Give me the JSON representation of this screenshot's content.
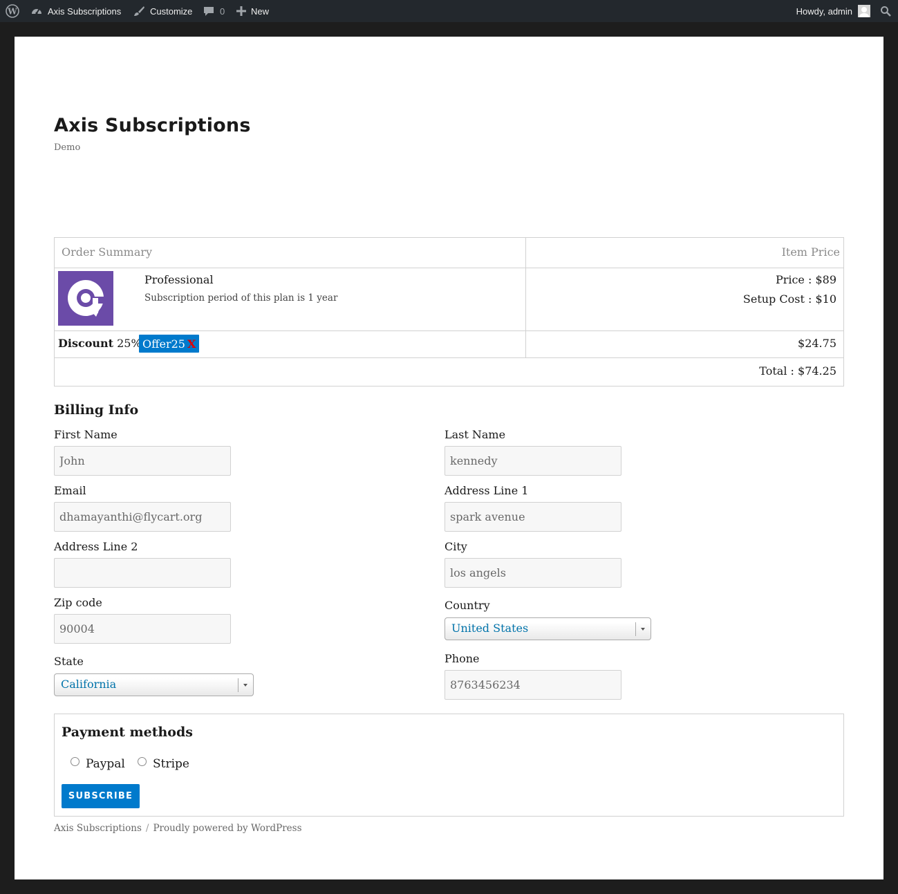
{
  "admin_bar": {
    "site_name": "Axis Subscriptions",
    "customize": "Customize",
    "comments_count": "0",
    "new_label": "New",
    "howdy": "Howdy, admin"
  },
  "site": {
    "title": "Axis Subscriptions",
    "description": "Demo"
  },
  "order": {
    "header_summary": "Order Summary",
    "header_price": "Item Price",
    "plan_name": "Professional",
    "plan_description": "Subscription period of this plan is 1 year",
    "price_line": "Price : $89",
    "setup_line": "Setup Cost : $10",
    "discount_label": "Discount",
    "discount_percent": "25%",
    "coupon_code": "Offer25",
    "coupon_remove": "X",
    "discount_amount": "$24.75",
    "total_line": "Total : $74.25"
  },
  "billing": {
    "title": "Billing Info",
    "first_name_label": "First Name",
    "first_name_value": "John",
    "last_name_label": "Last Name",
    "last_name_value": "kennedy",
    "email_label": "Email",
    "email_value": "dhamayanthi@flycart.org",
    "address1_label": "Address Line 1",
    "address1_value": "spark avenue",
    "address2_label": "Address Line 2",
    "address2_value": "",
    "city_label": "City",
    "city_value": "los angels",
    "zip_label": "Zip code",
    "zip_value": "90004",
    "country_label": "Country",
    "country_value": "United States",
    "state_label": "State",
    "state_value": "California",
    "phone_label": "Phone",
    "phone_value": "8763456234"
  },
  "payment": {
    "title": "Payment methods",
    "option_paypal": "Paypal",
    "option_stripe": "Stripe",
    "subscribe_label": "SUBSCRIBE"
  },
  "footer": {
    "site_link": "Axis Subscriptions",
    "separator": "/",
    "powered": "Proudly powered by WordPress"
  },
  "colors": {
    "admin_bar_bg": "#23282d",
    "accent_blue": "#007acc",
    "logo_purple": "#6b4ba8",
    "coupon_remove_red": "#e00000"
  }
}
